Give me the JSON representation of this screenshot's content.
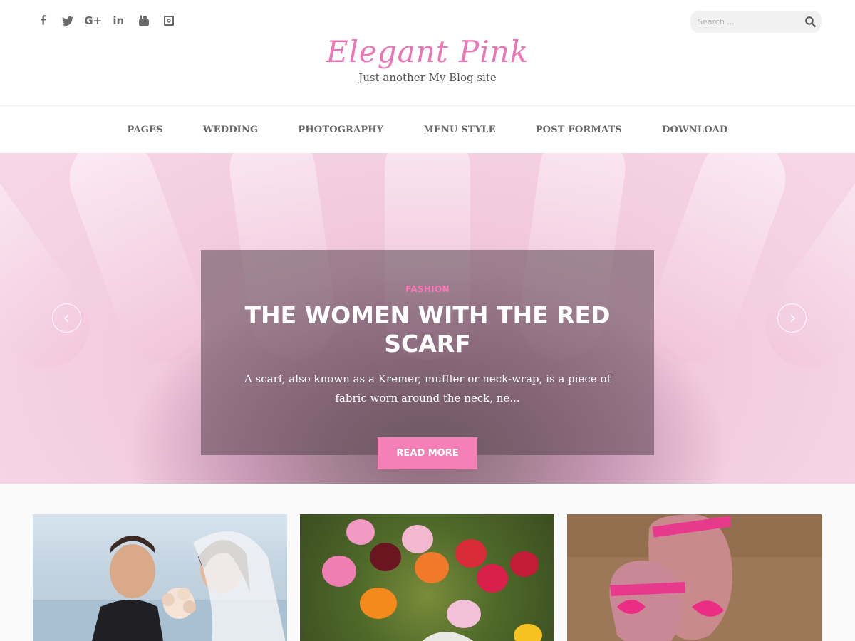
{
  "site": {
    "title": "Elegant Pink",
    "tagline": "Just another My Blog site"
  },
  "social": [
    {
      "name": "facebook",
      "icon": "facebook-icon"
    },
    {
      "name": "twitter",
      "icon": "twitter-icon"
    },
    {
      "name": "google-plus",
      "icon": "google-plus-icon"
    },
    {
      "name": "linkedin",
      "icon": "linkedin-icon"
    },
    {
      "name": "youtube",
      "icon": "youtube-icon"
    },
    {
      "name": "instagram",
      "icon": "instagram-icon"
    }
  ],
  "search": {
    "placeholder": "Search ..."
  },
  "nav": [
    "PAGES",
    "WEDDING",
    "PHOTOGRAPHY",
    "MENU STYLE",
    "POST FORMATS",
    "DOWNLOAD"
  ],
  "slider": {
    "category": "FASHION",
    "title": "THE WOMEN WITH THE RED SCARF",
    "excerpt": "A scarf, also known as a Kremer, muffler or neck-wrap, is a piece of fabric worn around the neck, ne...",
    "button": "READ MORE"
  },
  "colors": {
    "accent": "#f580b8",
    "brand": "#ec75b5"
  }
}
